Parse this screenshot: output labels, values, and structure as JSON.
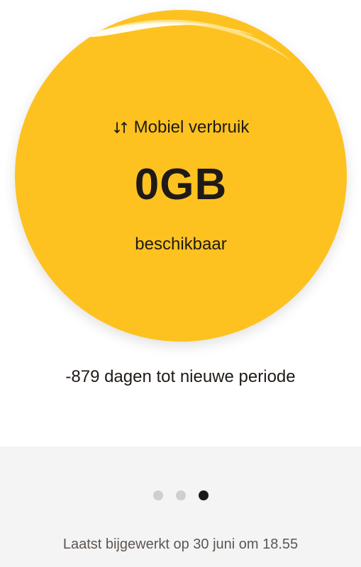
{
  "usage": {
    "label": "Mobiel verbruik",
    "amount": "0GB",
    "status": "beschikbaar",
    "icon": "up-down-arrows-icon"
  },
  "period": {
    "text": "-879 dagen tot nieuwe periode"
  },
  "pager": {
    "pages": 3,
    "active_page": 3
  },
  "footer": {
    "updated_text": "Laatst bijgewerkt op 30 juni om 18.55"
  },
  "colors": {
    "accent": "#fdc220",
    "text": "#1f1a17",
    "footer_bg": "#f4f4f4"
  }
}
